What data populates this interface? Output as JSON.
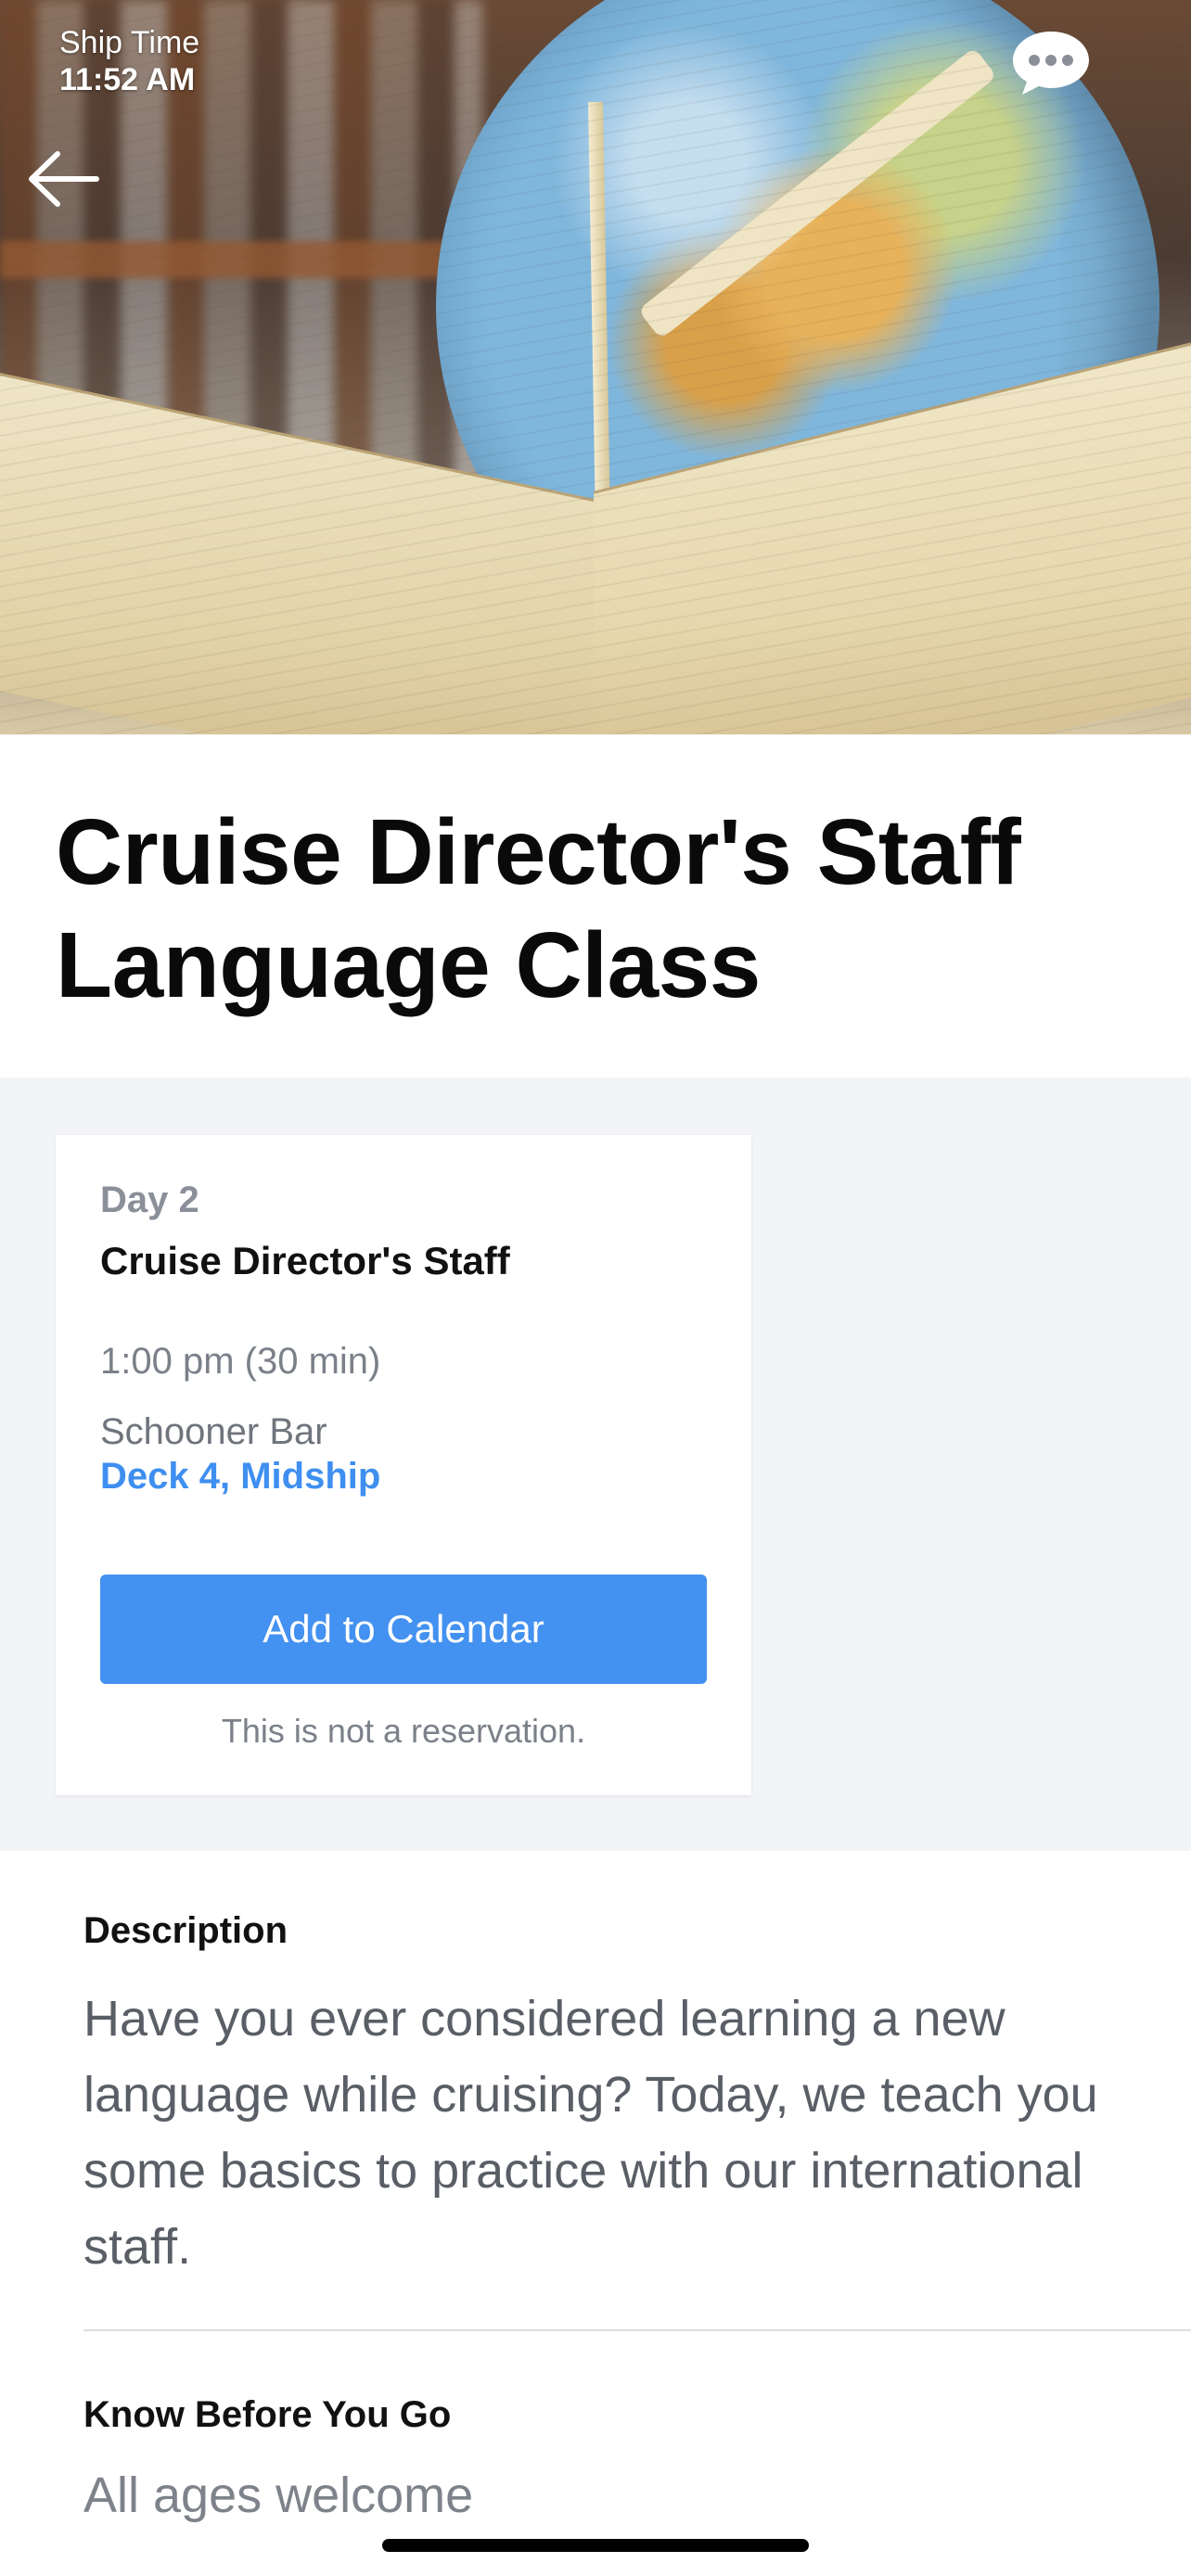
{
  "status": {
    "label": "Ship Time",
    "time": "11:52 AM"
  },
  "header": {
    "back_icon": "arrow-left-icon",
    "chat_icon": "chat-bubble-icon"
  },
  "event": {
    "title": "Cruise Director's Staff Language Class",
    "day": "Day 2",
    "host": "Cruise Director's Staff",
    "time": "1:00 pm (30 min)",
    "venue": "Schooner Bar",
    "deck": "Deck 4, Midship",
    "calendar_button": "Add to Calendar",
    "reservation_note": "This is not a reservation."
  },
  "description": {
    "heading": "Description",
    "text": "Have you ever considered learning a new language while cruising? Today, we teach you some basics to practice with our international staff."
  },
  "know_before": {
    "heading": "Know Before You Go",
    "text": "All ages welcome"
  },
  "colors": {
    "accent": "#4391f0",
    "link": "#3e8ff0",
    "band": "#f3f4f8"
  }
}
